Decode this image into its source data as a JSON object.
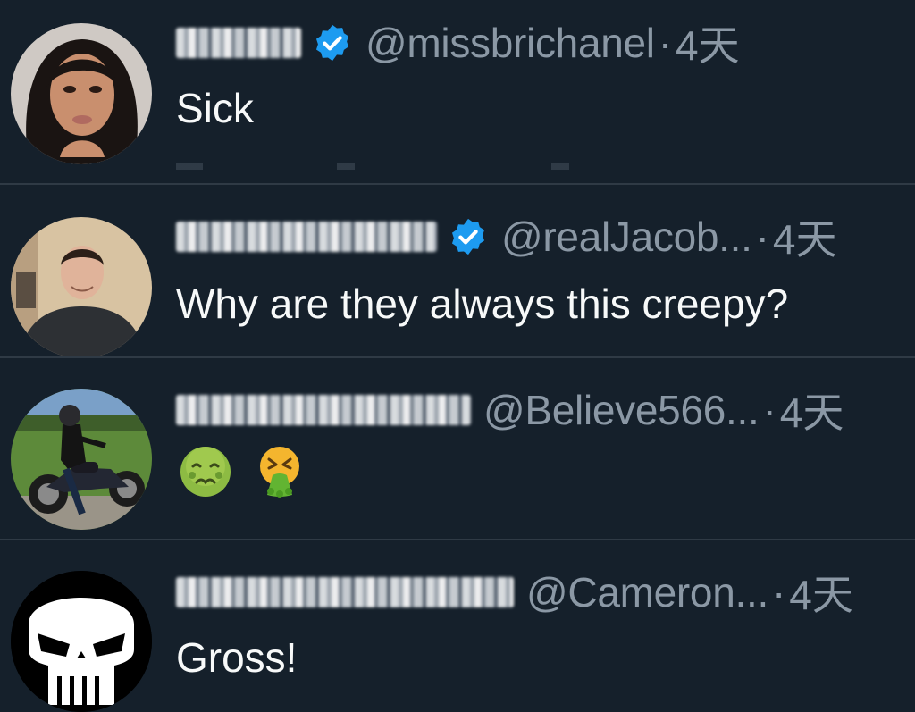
{
  "colors": {
    "background": "#15202b",
    "verified_badge": "#1d9bf0",
    "secondary_text": "#8b98a5",
    "primary_text": "#f7f9f9"
  },
  "replies": [
    {
      "display_name_obscured": true,
      "verified": true,
      "handle": "@missbrichanel",
      "separator": "·",
      "time": "4天",
      "text": "Sick",
      "avatar": "woman-portrait-avatar"
    },
    {
      "display_name_obscured": true,
      "verified": true,
      "handle": "@realJacob...",
      "separator": "·",
      "time": "4天",
      "text": "Why are they always this creepy?",
      "avatar": "man-portrait-avatar"
    },
    {
      "display_name_obscured": true,
      "verified": false,
      "handle": "@Believe566...",
      "separator": "·",
      "time": "4天",
      "text": "",
      "emojis": [
        "nauseated-face-emoji",
        "vomiting-face-emoji"
      ],
      "avatar": "motorcycle-rider-avatar"
    },
    {
      "display_name_obscured": true,
      "verified": false,
      "handle": "@Cameron...",
      "separator": "·",
      "time": "4天",
      "text": "Gross!",
      "avatar": "punisher-skull-avatar"
    }
  ]
}
